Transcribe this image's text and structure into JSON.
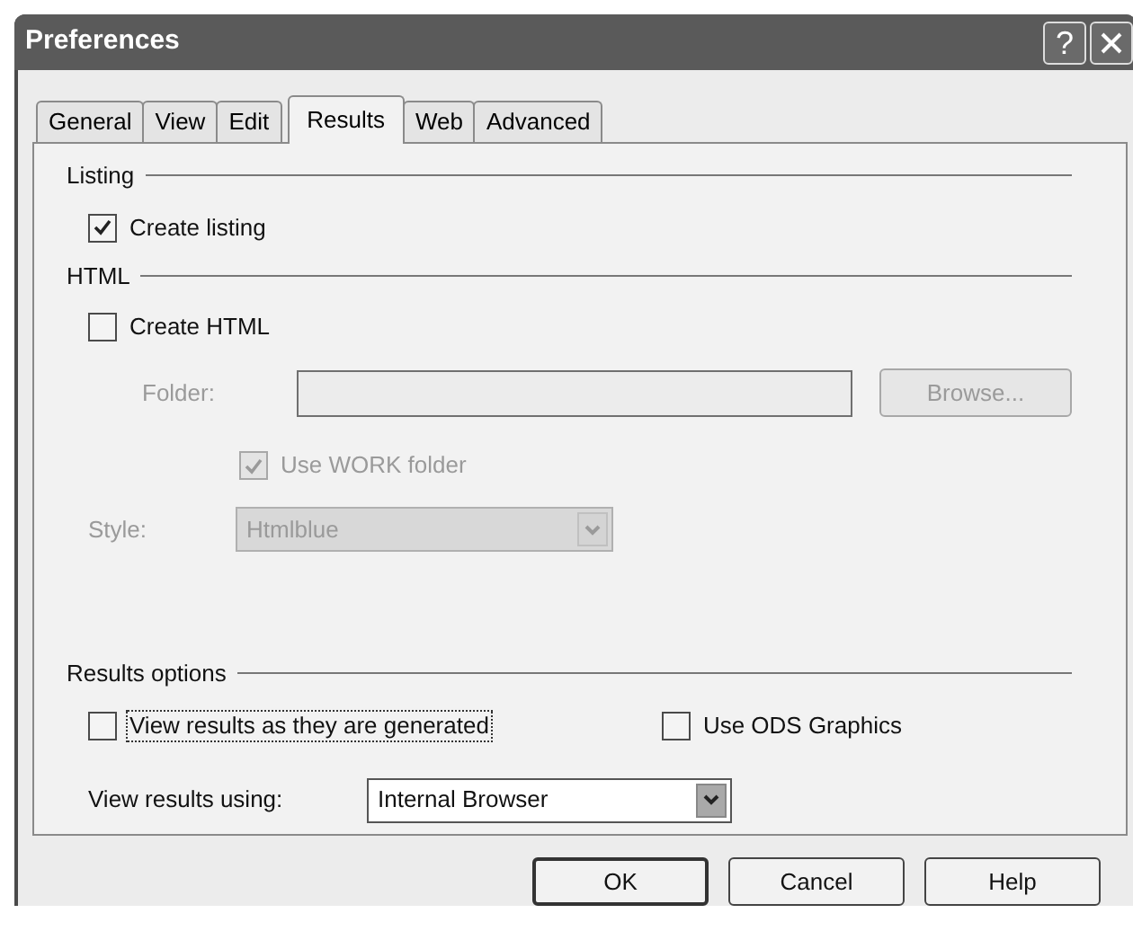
{
  "window": {
    "title": "Preferences",
    "help_button": "?"
  },
  "tabs": [
    {
      "label": "General",
      "selected": false
    },
    {
      "label": "View",
      "selected": false
    },
    {
      "label": "Edit",
      "selected": false
    },
    {
      "label": "Results",
      "selected": true
    },
    {
      "label": "Web",
      "selected": false
    },
    {
      "label": "Advanced",
      "selected": false
    }
  ],
  "sections": [
    {
      "title": "Listing",
      "items": [
        {
          "kind": "checkbox",
          "label": "Create listing",
          "checked": true,
          "disabled": false,
          "focused": false
        }
      ]
    },
    {
      "title": "HTML",
      "items": [
        {
          "kind": "checkbox",
          "label": "Create HTML",
          "checked": false,
          "disabled": false,
          "focused": false
        },
        {
          "kind": "folder",
          "label": "Folder:",
          "button": "Browse...",
          "disabled": true
        },
        {
          "kind": "subcheckbox",
          "label": "Use WORK folder",
          "checked": true,
          "disabled": true,
          "focused": false
        },
        {
          "kind": "select",
          "label": "Style:",
          "value": "Htmlblue",
          "disabled": true
        }
      ]
    },
    {
      "title": "Results options",
      "items": [
        {
          "kind": "checkbox_row",
          "options": [
            {
              "label": "View results as they are generated",
              "checked": false,
              "disabled": false,
              "focused": true
            },
            {
              "label": "Use ODS Graphics",
              "checked": false,
              "disabled": false,
              "focused": false
            }
          ]
        },
        {
          "kind": "select",
          "label": "View results using:",
          "value": "Internal Browser",
          "disabled": false
        }
      ]
    }
  ],
  "buttons": [
    {
      "label": "OK",
      "default": true
    },
    {
      "label": "Cancel",
      "default": false
    },
    {
      "label": "Help",
      "default": false
    }
  ]
}
